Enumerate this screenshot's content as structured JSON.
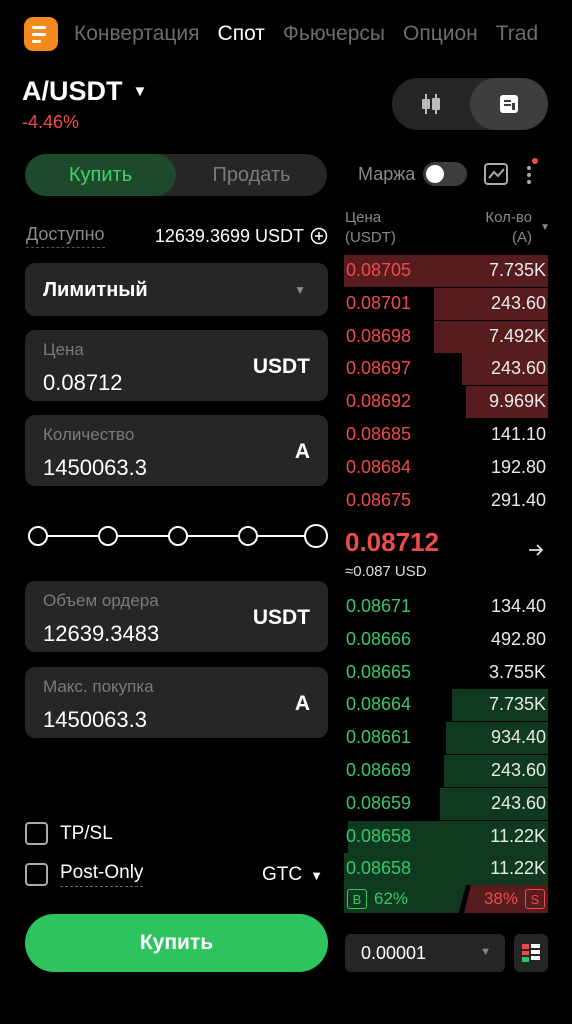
{
  "nav": {
    "tabs": [
      "Конвертация",
      "Спот",
      "Фьючерсы",
      "Опцион",
      "Trad"
    ],
    "active_index": 1
  },
  "pair": {
    "symbol": "A/USDT",
    "change": "-4.46%"
  },
  "order_form": {
    "buy_label": "Купить",
    "sell_label": "Продать",
    "available_label": "Доступно",
    "available_value": "12639.3699 USDT",
    "order_type": "Лимитный",
    "price": {
      "label": "Цена",
      "value": "0.08712",
      "unit": "USDT"
    },
    "quantity": {
      "label": "Количество",
      "value": "1450063.3",
      "unit": "A"
    },
    "slider_percent": 100,
    "order_value": {
      "label": "Объем ордера",
      "value": "12639.3483",
      "unit": "USDT"
    },
    "max_buy": {
      "label": "Макс. покупка",
      "value": "1450063.3",
      "unit": "A"
    },
    "tpsl_label": "TP/SL",
    "post_only_label": "Post-Only",
    "tif": "GTC",
    "submit_label": "Купить"
  },
  "order_book": {
    "margin_label": "Маржа",
    "price_header_1": "Цена",
    "price_header_2": "(USDT)",
    "qty_header_1": "Кол-во",
    "qty_header_2": "(A)",
    "asks": [
      {
        "price": "0.08705",
        "qty": "7.735K",
        "depth": 1.0
      },
      {
        "price": "0.08701",
        "qty": "243.60",
        "depth": 0.56
      },
      {
        "price": "0.08698",
        "qty": "7.492K",
        "depth": 0.56
      },
      {
        "price": "0.08697",
        "qty": "243.60",
        "depth": 0.42
      },
      {
        "price": "0.08692",
        "qty": "9.969K",
        "depth": 0.4
      },
      {
        "price": "0.08685",
        "qty": "141.10",
        "depth": 0
      },
      {
        "price": "0.08684",
        "qty": "192.80",
        "depth": 0
      },
      {
        "price": "0.08675",
        "qty": "291.40",
        "depth": 0
      }
    ],
    "last_price": "0.08712",
    "last_price_usd": "≈0.087 USD",
    "bids": [
      {
        "price": "0.08671",
        "qty": "134.40",
        "depth": 0
      },
      {
        "price": "0.08666",
        "qty": "492.80",
        "depth": 0
      },
      {
        "price": "0.08665",
        "qty": "3.755K",
        "depth": 0
      },
      {
        "price": "0.08664",
        "qty": "7.735K",
        "depth": 0.47
      },
      {
        "price": "0.08661",
        "qty": "934.40",
        "depth": 0.5
      },
      {
        "price": "0.08669",
        "qty": "243.60",
        "depth": 0.51
      },
      {
        "price": "0.08659",
        "qty": "243.60",
        "depth": 0.53
      },
      {
        "price": "0.08658",
        "qty": "11.22K",
        "depth": 0.98
      },
      {
        "price": "0.08658",
        "qty": "11.22K",
        "depth": 1.0
      }
    ],
    "buy_tag": "B",
    "buy_ratio": "62%",
    "sell_ratio": "38%",
    "sell_tag": "S",
    "tick_size": "0.00001"
  },
  "colors": {
    "buy": "#2dc460",
    "sell": "#ef4b4b",
    "accent": "#f28a1d"
  }
}
